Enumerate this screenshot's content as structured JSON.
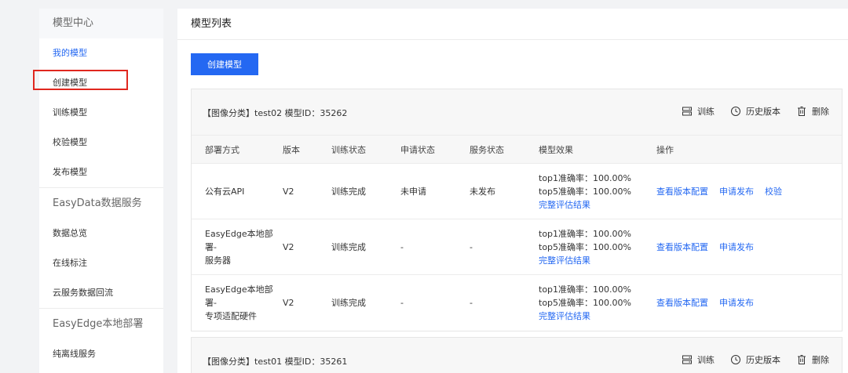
{
  "sidebar": {
    "heading": "模型中心",
    "items": [
      {
        "label": "我的模型"
      },
      {
        "label": "创建模型"
      },
      {
        "label": "训练模型"
      },
      {
        "label": "校验模型"
      },
      {
        "label": "发布模型"
      }
    ],
    "group1": "EasyData数据服务",
    "group1_items": [
      {
        "label": "数据总览"
      },
      {
        "label": "在线标注"
      },
      {
        "label": "云服务数据回流"
      }
    ],
    "group2": "EasyEdge本地部署",
    "group2_items": [
      {
        "label": "纯离线服务"
      }
    ]
  },
  "main": {
    "title": "模型列表",
    "create_button": "创建模型",
    "actions": {
      "train": "训练",
      "history": "历史版本",
      "delete": "删除"
    },
    "columns": [
      "部署方式",
      "版本",
      "训练状态",
      "申请状态",
      "服务状态",
      "模型效果",
      "操作"
    ],
    "models": [
      {
        "title": "【图像分类】test02 模型ID：35262",
        "rows": [
          {
            "deploy_line1": "公有云API",
            "deploy_line2": "",
            "version": "V2",
            "train_status": "训练完成",
            "apply_status": "未申请",
            "service_status": "未发布",
            "top1": "top1准确率：100.00%",
            "top5": "top5准确率：100.00%",
            "eval_link": "完整评估结果",
            "op1": "查看版本配置",
            "op2": "申请发布",
            "op3": "校验"
          },
          {
            "deploy_line1": "EasyEdge本地部署-",
            "deploy_line2": "服务器",
            "version": "V2",
            "train_status": "训练完成",
            "apply_status": "-",
            "service_status": "-",
            "top1": "top1准确率：100.00%",
            "top5": "top5准确率：100.00%",
            "eval_link": "完整评估结果",
            "op1": "查看版本配置",
            "op2": "申请发布",
            "op3": ""
          },
          {
            "deploy_line1": "EasyEdge本地部署-",
            "deploy_line2": "专项适配硬件",
            "version": "V2",
            "train_status": "训练完成",
            "apply_status": "-",
            "service_status": "-",
            "top1": "top1准确率：100.00%",
            "top5": "top5准确率：100.00%",
            "eval_link": "完整评估结果",
            "op1": "查看版本配置",
            "op2": "申请发布",
            "op3": ""
          }
        ]
      },
      {
        "title": "【图像分类】test01 模型ID：35261"
      }
    ]
  },
  "colors": {
    "accent": "#2468f2",
    "highlight": "#e0271f"
  }
}
